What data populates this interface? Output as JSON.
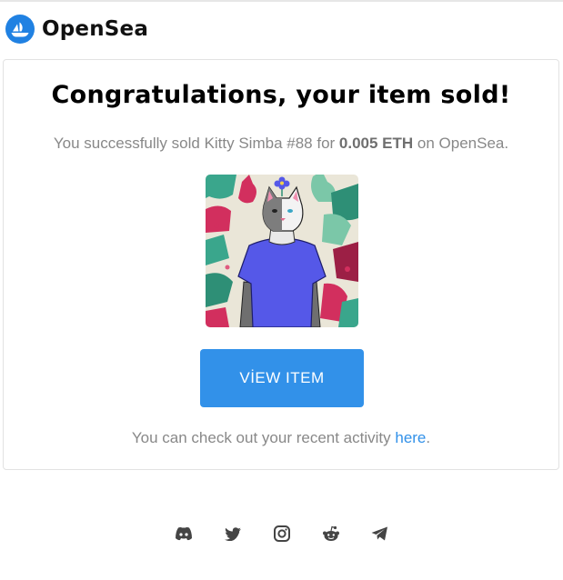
{
  "brand": {
    "name": "OpenSea",
    "accent": "#2081e2"
  },
  "card": {
    "title": "Congratulations, your item sold!",
    "sold_prefix": "You successfully sold ",
    "item_name": "Kitty Simba #88",
    "sold_middle": " for ",
    "price": "0.005 ETH",
    "sold_suffix": " on OpenSea.",
    "nft_image": "kitty-simba-88-image",
    "cta_label": "VİEW ITEM",
    "activity_prefix": "You can check out your recent activity ",
    "activity_link": "here",
    "activity_suffix": "."
  },
  "colors": {
    "button": "#3291e9",
    "link": "#3291e9",
    "muted_text": "#888888"
  },
  "socials": [
    {
      "icon": "discord-icon"
    },
    {
      "icon": "twitter-icon"
    },
    {
      "icon": "instagram-icon"
    },
    {
      "icon": "reddit-icon"
    },
    {
      "icon": "telegram-icon"
    }
  ]
}
